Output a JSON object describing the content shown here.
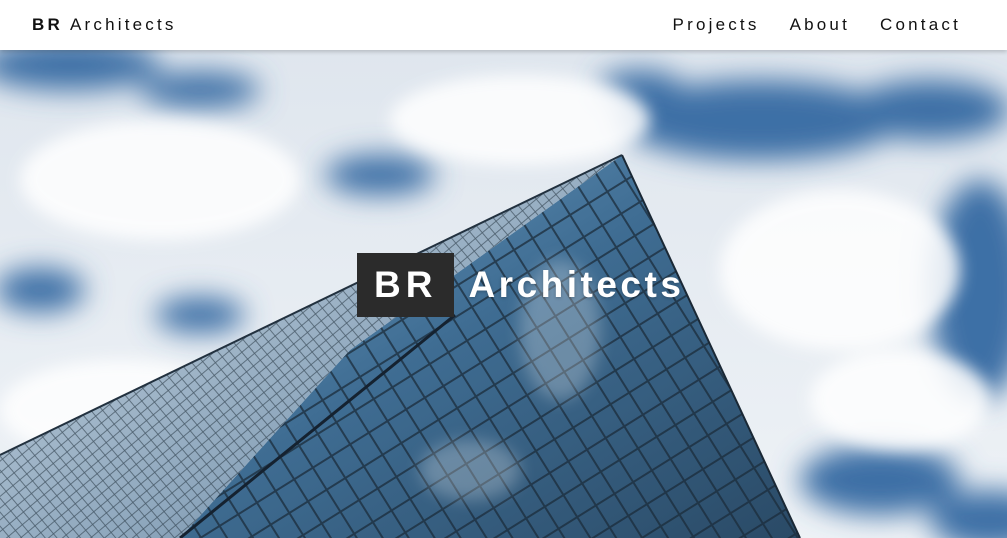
{
  "brand": {
    "bold": "BR",
    "light": "Architects"
  },
  "nav": {
    "links": [
      "Projects",
      "About",
      "Contact"
    ]
  },
  "hero": {
    "title_bold": "BR",
    "title_light": "Architects"
  },
  "colors": {
    "navbar": "#ffffff",
    "title_box": "#2b2b2b",
    "sky": "#3f6fa8",
    "glass": "#2f5b7a"
  }
}
